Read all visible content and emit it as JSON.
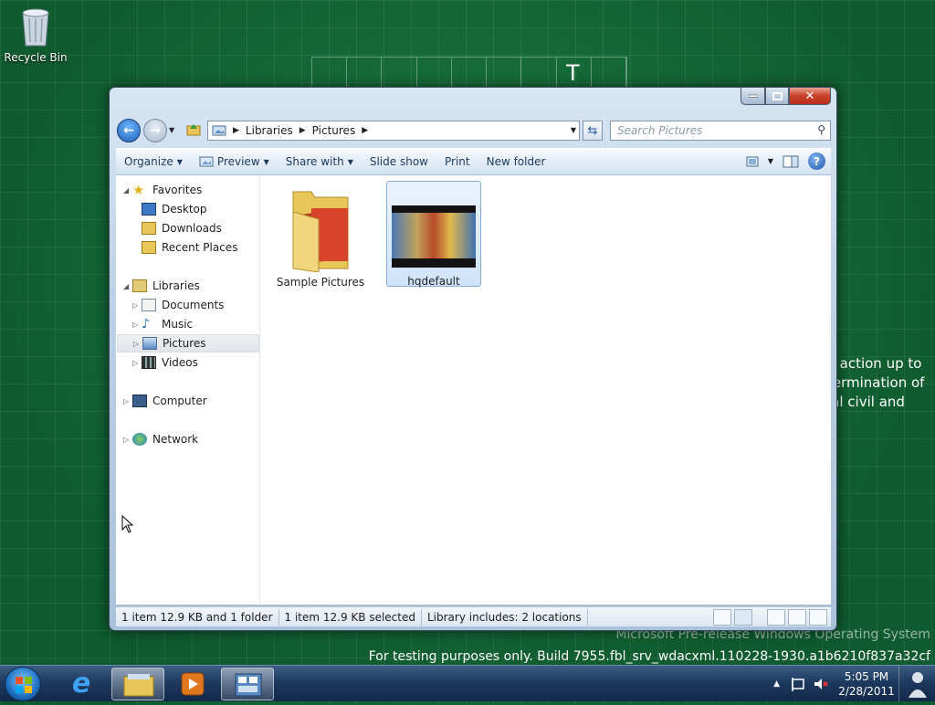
{
  "desktop": {
    "recycle_bin_label": "Recycle Bin",
    "grid_letter": "T",
    "behind_text": [
      "y action up to",
      "termination of",
      "ial civil and"
    ],
    "watermark_line1": "Microsoft Pre-release Windows Operating System",
    "watermark_line2": "For testing purposes only. Build 7955.fbl_srv_wdacxml.110228-1930.a1b6210f837a32cf"
  },
  "window": {
    "address": {
      "seg1": "Libraries",
      "seg2": "Pictures"
    },
    "search_placeholder": "Search Pictures",
    "toolbar": {
      "organize": "Organize",
      "preview": "Preview",
      "share_with": "Share with",
      "slide_show": "Slide show",
      "print": "Print",
      "new_folder": "New folder"
    },
    "nav": {
      "favorites": "Favorites",
      "desktop": "Desktop",
      "downloads": "Downloads",
      "recent_places": "Recent Places",
      "libraries": "Libraries",
      "documents": "Documents",
      "music": "Music",
      "pictures": "Pictures",
      "videos": "Videos",
      "computer": "Computer",
      "network": "Network"
    },
    "files": [
      {
        "name": "Sample Pictures",
        "kind": "folder"
      },
      {
        "name": "hqdefault",
        "kind": "image"
      }
    ],
    "status": {
      "s1": "1 item 12.9 KB and 1 folder",
      "s2": "1 item 12.9 KB selected",
      "s3": "Library includes:  2 locations"
    }
  },
  "taskbar": {
    "time": "5:05 PM",
    "date": "2/28/2011"
  },
  "colors": {
    "accent": "#1e5fb8",
    "desktop": "#0f5a2e",
    "close": "#c8402a"
  }
}
